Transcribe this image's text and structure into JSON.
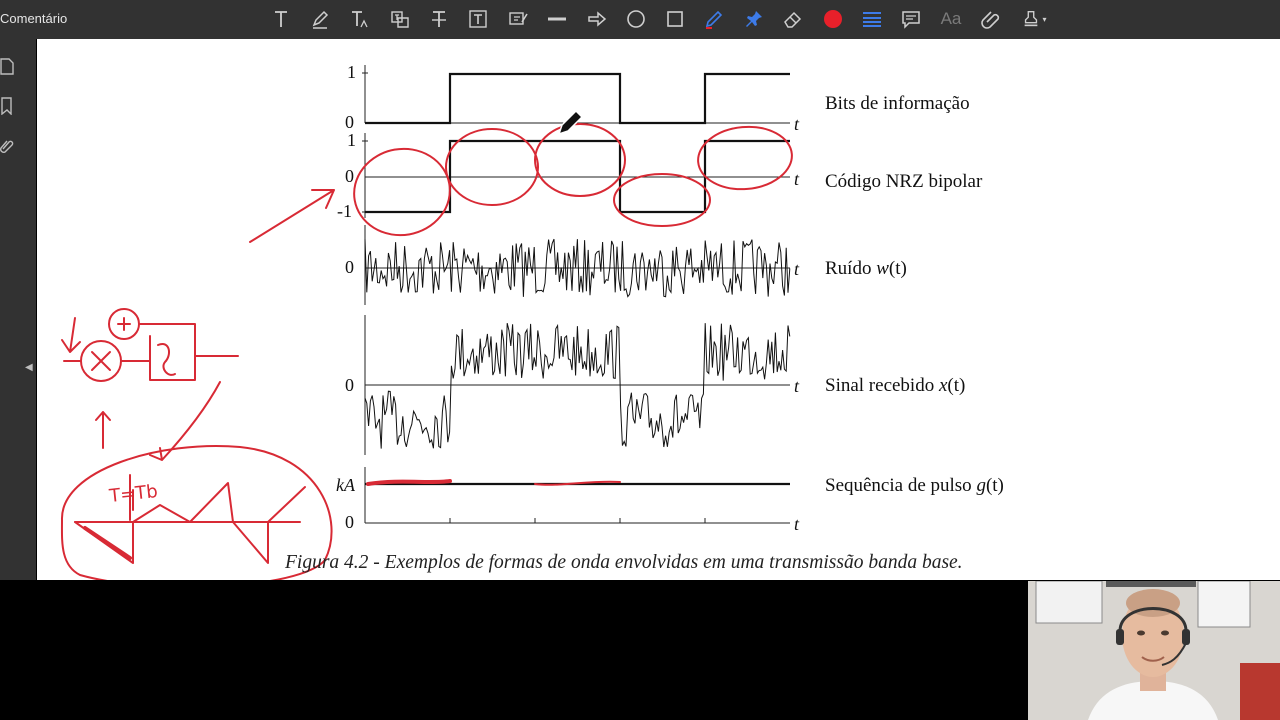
{
  "toolbar": {
    "title": "Comentário",
    "tools": [
      {
        "name": "text-tool",
        "icon": "text-icon"
      },
      {
        "name": "highlight-tool",
        "icon": "highlighter-icon"
      },
      {
        "name": "text-size-tool",
        "icon": "text-size-icon"
      },
      {
        "name": "text-replace-tool",
        "icon": "text-replace-icon"
      },
      {
        "name": "strikethrough-tool",
        "icon": "strikethrough-icon"
      },
      {
        "name": "textbox-tool",
        "icon": "textbox-icon"
      },
      {
        "name": "text-edit-tool",
        "icon": "text-edit-icon"
      },
      {
        "name": "line-tool",
        "icon": "line-icon"
      },
      {
        "name": "arrow-tool",
        "icon": "arrow-icon"
      },
      {
        "name": "ellipse-tool",
        "icon": "circle-icon"
      },
      {
        "name": "rectangle-tool",
        "icon": "square-icon"
      },
      {
        "name": "pencil-tool",
        "icon": "pencil-icon"
      },
      {
        "name": "pin-tool",
        "icon": "pin-icon"
      },
      {
        "name": "eraser-tool",
        "icon": "eraser-icon"
      },
      {
        "name": "color-tool",
        "icon": "color-dot-icon"
      },
      {
        "name": "line-weight-tool",
        "icon": "line-weight-icon"
      },
      {
        "name": "comment-tool",
        "icon": "comment-icon"
      },
      {
        "name": "font-tool",
        "icon": "font-icon",
        "label": "Aa"
      },
      {
        "name": "attach-tool",
        "icon": "attach-icon"
      },
      {
        "name": "stamp-tool",
        "icon": "stamp-icon"
      }
    ],
    "accent_red": "#e8202a",
    "accent_blue": "#3d7be8"
  },
  "figure": {
    "labels": {
      "bits": "Bits de informação",
      "nrz": "Código NRZ bipolar",
      "noise_prefix": "Ruído ",
      "noise_var": "w",
      "noise_suffix": "(t)",
      "received_prefix": "Sinal recebido ",
      "received_var": "x",
      "received_suffix": "(t)",
      "pulse_prefix": "Sequência de pulso ",
      "pulse_var": "g",
      "pulse_suffix": "(t)"
    },
    "ticks": {
      "one": "1",
      "zero": "0",
      "minus_one": "-1",
      "kA": "kA",
      "t": "t"
    },
    "bits": [
      0,
      1,
      1,
      0,
      1
    ],
    "caption": "Figura 4.2 - Exemplos de formas de onda envolvidas em uma transmissão banda base.",
    "annotation_color": "#d82a35",
    "handwritten_label": "T=Tb"
  }
}
